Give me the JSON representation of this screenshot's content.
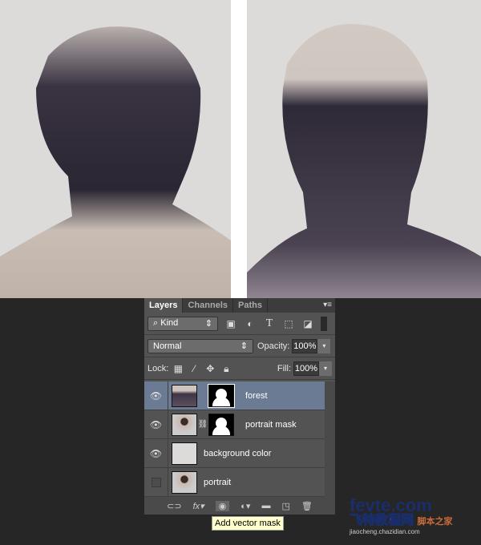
{
  "panel": {
    "tabs": [
      {
        "label": "Layers",
        "active": true
      },
      {
        "label": "Channels"
      },
      {
        "label": "Paths"
      }
    ],
    "filter": {
      "label": "Kind",
      "icons": [
        "image-filter-icon",
        "adjustment-filter-icon",
        "type-filter-icon",
        "shape-filter-icon",
        "smart-object-filter-icon"
      ]
    },
    "blend_mode": "Normal",
    "opacity_label": "Opacity:",
    "opacity": "100%",
    "lock_label": "Lock:",
    "fill_label": "Fill:",
    "fill": "100%",
    "layers": [
      {
        "name": "forest",
        "visible": true,
        "active": true,
        "has_mask": true
      },
      {
        "name": "portrait mask",
        "visible": true,
        "has_mask": true,
        "linked": true
      },
      {
        "name": "background color",
        "visible": true
      },
      {
        "name": "portrait",
        "visible": false
      }
    ],
    "bottom_icons": [
      "link-layers-icon",
      "fx-icon",
      "add-mask-icon",
      "adjustment-layer-icon",
      "group-folder-icon",
      "new-layer-icon",
      "trash-icon"
    ]
  },
  "tooltip": "Add vector mask",
  "watermark": {
    "line1": "fevte.com",
    "line2": "飞特教程网",
    "line3": "脚本之家",
    "line4": "jiaocheng.chazidian.com"
  },
  "colors": {
    "active_layer": "#6a7b93",
    "panel": "#535353",
    "tooltip": "#ffffcc"
  }
}
